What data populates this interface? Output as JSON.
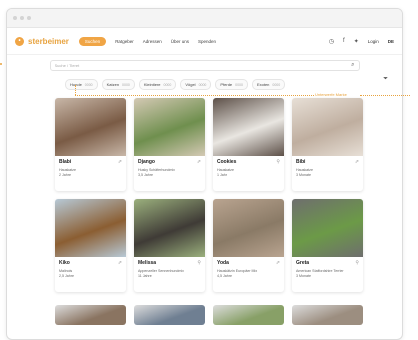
{
  "brand": {
    "name": "sterbeimer",
    "accent": "#f0a545"
  },
  "nav": {
    "items": [
      {
        "label": "Suchen",
        "active": true
      },
      {
        "label": "Ratgeber",
        "active": false
      },
      {
        "label": "Adressen",
        "active": false
      },
      {
        "label": "Über uns",
        "active": false
      },
      {
        "label": "Spenden",
        "active": false
      }
    ],
    "icons": [
      "clock-icon",
      "facebook-icon",
      "twitter-icon"
    ],
    "login": "Login",
    "lang": "DE"
  },
  "search": {
    "placeholder": "Suche / Tieret"
  },
  "filters": [
    {
      "label": "Hunde",
      "count": "0000"
    },
    {
      "label": "Katzen",
      "count": "0000"
    },
    {
      "label": "Kleintiere",
      "count": "0000"
    },
    {
      "label": "Vögel",
      "count": "0000"
    },
    {
      "label": "Pferde",
      "count": "0000"
    },
    {
      "label": "Exoten",
      "count": "0000"
    }
  ],
  "annotation": {
    "text": "Unterwerfe Marke"
  },
  "cards": [
    {
      "name": "Blabi",
      "breed": "Hauskatze",
      "age": "2 Jahre",
      "fav": "share-icon",
      "colors": [
        "#7a5b45",
        "#c8b7a8"
      ]
    },
    {
      "name": "Django",
      "breed": "Husky Schäferhundmix",
      "age": "3,5 Jahre",
      "fav": "share-icon",
      "colors": [
        "#6f8f4e",
        "#d4c9b4"
      ]
    },
    {
      "name": "Cookies",
      "breed": "Hauskatze",
      "age": "1 Jahr",
      "fav": "pin-icon",
      "colors": [
        "#e9e6e1",
        "#5d5048"
      ]
    },
    {
      "name": "Bibi",
      "breed": "Hauskatze",
      "age": "3 Monate",
      "fav": "share-icon",
      "colors": [
        "#bfae9f",
        "#e7dfd6"
      ]
    },
    {
      "name": "Kiko",
      "breed": "Malinois",
      "age": "2,5 Jahre",
      "fav": "share-icon",
      "colors": [
        "#8b5e32",
        "#b7c9d6"
      ]
    },
    {
      "name": "Melissa",
      "breed": "Appenzeller Sennenhundmix",
      "age": "11 Jahre",
      "fav": "pin-icon",
      "colors": [
        "#3f3b36",
        "#9bb07d"
      ]
    },
    {
      "name": "Yoda",
      "breed": "Hauskätzin Europäer Mix",
      "age": "4,5 Jahre",
      "fav": "share-icon",
      "colors": [
        "#8a7a66",
        "#b9a490"
      ]
    },
    {
      "name": "Greta",
      "breed": "American Staffordshire Terrier",
      "age": "3 Monate",
      "fav": "pin-icon",
      "colors": [
        "#6c9a47",
        "#6e6e6e"
      ]
    }
  ],
  "row3_colors": [
    "#8a7461",
    "#6f7f92",
    "#88a067",
    "#9c8e80"
  ]
}
